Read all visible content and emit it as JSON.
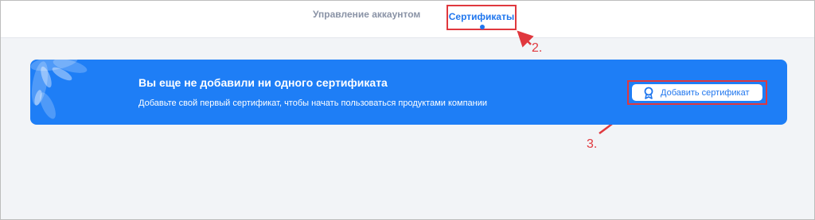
{
  "nav": {
    "tabs": [
      {
        "label": "Управление аккаунтом",
        "active": false
      },
      {
        "label": "Сертификаты",
        "active": true
      }
    ]
  },
  "banner": {
    "title": "Вы еще не добавили ни одного сертификата",
    "subtitle": "Добавьте свой первый сертификат, чтобы начать пользоваться продуктами компании",
    "button_label": "Добавить сертификат",
    "button_icon": "award-icon",
    "background_color": "#1e7ef6"
  },
  "annotations": {
    "step2": "2.",
    "step3": "3."
  },
  "colors": {
    "accent": "#1f76ee",
    "annotation": "#e0383e",
    "page_bg": "#f2f4f7"
  }
}
